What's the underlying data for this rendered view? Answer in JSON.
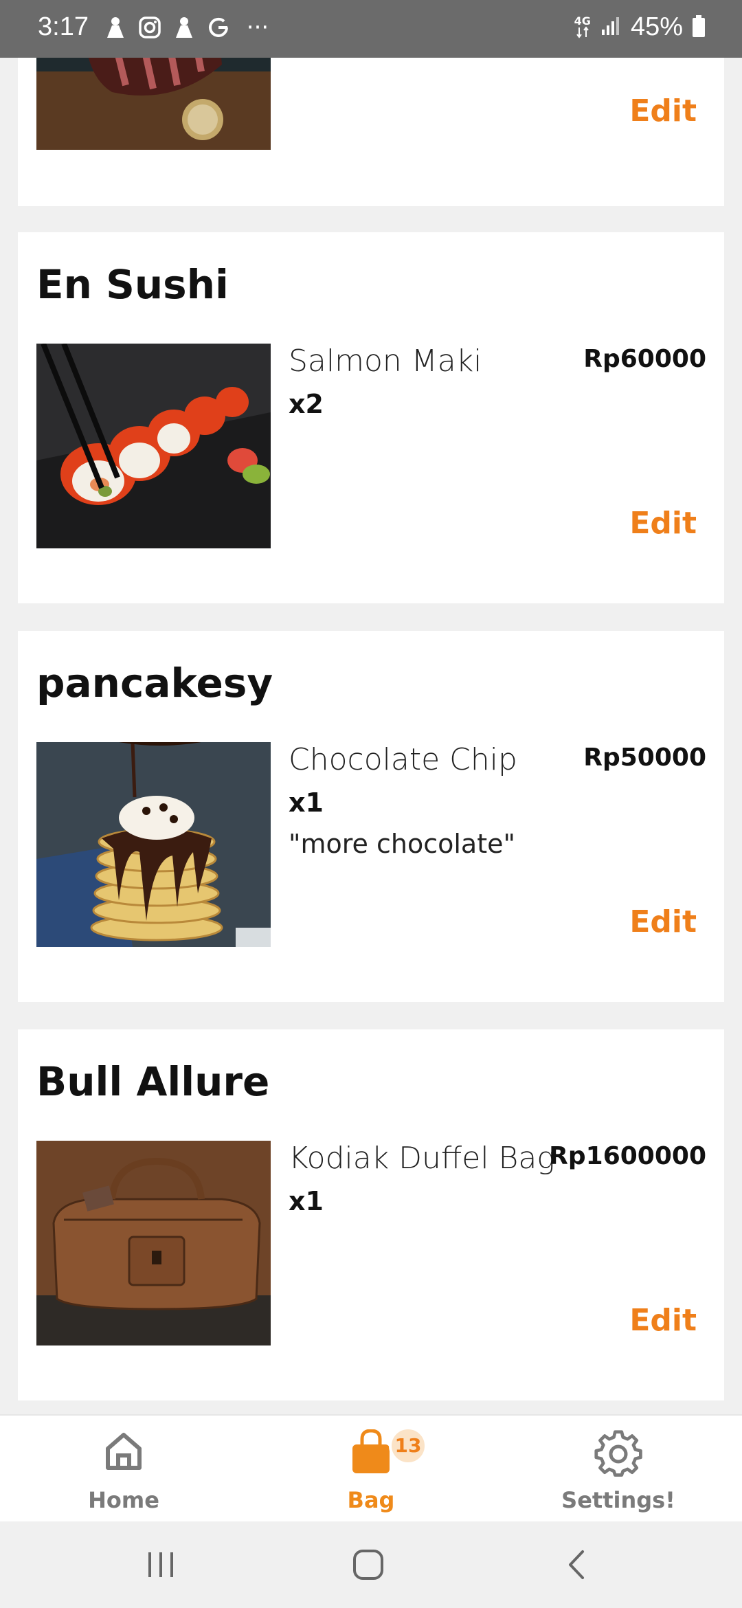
{
  "status_bar": {
    "time": "3:17",
    "more_indicator": "···",
    "network_label": "4G",
    "battery_text": "45%",
    "icons": [
      "notification-person-icon",
      "instagram-icon",
      "notification-person-icon",
      "google-icon",
      "network-4g-icon",
      "signal-icon",
      "battery-icon"
    ]
  },
  "cart": {
    "stores": [
      {
        "name": "",
        "items": [
          {
            "name": "",
            "qty": "",
            "price": "",
            "note": "",
            "edit_label": "Edit",
            "image": "steak-photo"
          }
        ]
      },
      {
        "name": "En Sushi",
        "items": [
          {
            "name": "Salmon Maki",
            "qty": "x2",
            "price": "Rp60000",
            "note": "",
            "edit_label": "Edit",
            "image": "sushi-photo"
          }
        ]
      },
      {
        "name": "pancakesy",
        "items": [
          {
            "name": "Chocolate Chip",
            "qty": "x1",
            "price": "Rp50000",
            "note": "\"more chocolate\"",
            "edit_label": "Edit",
            "image": "pancake-photo"
          }
        ]
      },
      {
        "name": "Bull Allure",
        "items": [
          {
            "name": "Kodiak Duffel Bag",
            "qty": "x1",
            "price": "Rp1600000",
            "note": "",
            "edit_label": "Edit",
            "image": "duffel-bag-photo"
          }
        ]
      }
    ]
  },
  "bottom_nav": {
    "home_label": "Home",
    "bag_label": "Bag",
    "bag_badge": "13",
    "settings_label": "Settings!",
    "active": "bag"
  },
  "colors": {
    "accent": "#ef7f1a",
    "status_bar": "#6b6b6b",
    "background": "#f0f0f0",
    "card": "#ffffff"
  }
}
